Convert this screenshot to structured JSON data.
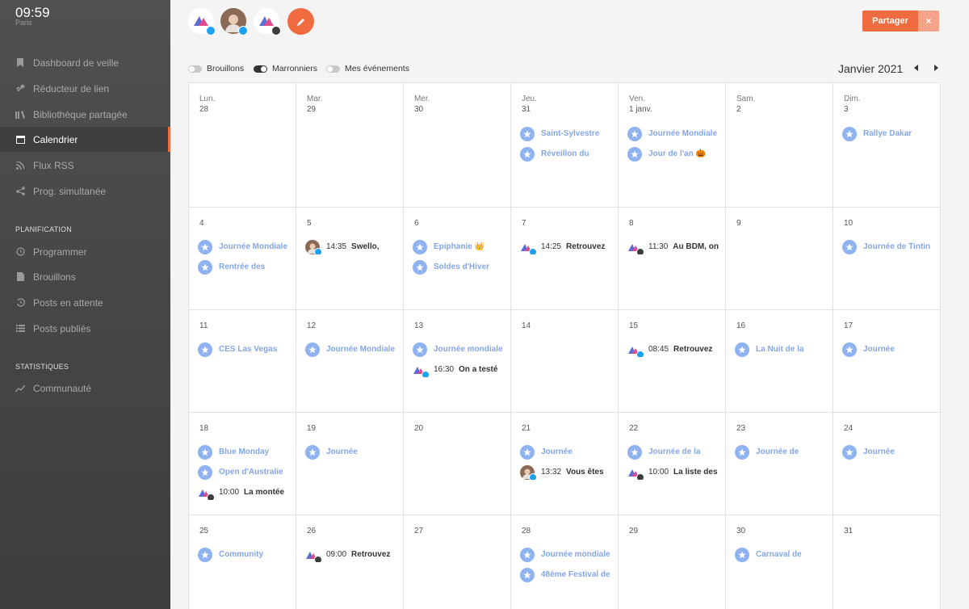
{
  "clock": {
    "time": "09:59",
    "city": "Paris"
  },
  "nav": [
    {
      "label": "Dashboard de veille",
      "icon": "bookmark-icon"
    },
    {
      "label": "Réducteur de lien",
      "icon": "link-icon"
    },
    {
      "label": "Bibliothèque partagée",
      "icon": "library-icon"
    },
    {
      "label": "Calendrier",
      "icon": "calendar-icon",
      "active": true
    },
    {
      "label": "Flux RSS",
      "icon": "rss-icon"
    },
    {
      "label": "Prog. simultanée",
      "icon": "share-icon"
    }
  ],
  "planification": {
    "title": "PLANIFICATION",
    "items": [
      {
        "label": "Programmer",
        "icon": "clock-icon"
      },
      {
        "label": "Brouillons",
        "icon": "draft-icon"
      },
      {
        "label": "Posts en attente",
        "icon": "history-icon"
      },
      {
        "label": "Posts publiés",
        "icon": "list-icon"
      }
    ]
  },
  "statistiques": {
    "title": "STATISTIQUES",
    "items": [
      {
        "label": "Communauté",
        "icon": "chart-line-icon"
      }
    ]
  },
  "toolbar": {
    "share_label": "Partager",
    "close_label": "×"
  },
  "toggles": [
    {
      "label": "Brouillons",
      "on": false
    },
    {
      "label": "Marronniers",
      "on": true
    },
    {
      "label": "Mes événements",
      "on": false
    }
  ],
  "month_label": "Janvier 2021",
  "colors": {
    "accent": "#f06b3f",
    "event_blue": "#84a6e6",
    "twitter": "#1da1f2",
    "facebook": "#3b3d3f"
  },
  "weeks": [
    [
      {
        "dow": "Lun.",
        "day": "28",
        "events": []
      },
      {
        "dow": "Mar.",
        "day": "29",
        "events": []
      },
      {
        "dow": "Mer.",
        "day": "30",
        "events": []
      },
      {
        "dow": "Jeu.",
        "day": "31",
        "events": [
          {
            "type": "star",
            "text": "Saint-Sylvestre"
          },
          {
            "type": "star",
            "text": "Réveillon du"
          }
        ]
      },
      {
        "dow": "Ven.",
        "day": "1 janv.",
        "events": [
          {
            "type": "star",
            "text": "Journée Mondiale"
          },
          {
            "type": "star",
            "text": "Jour de l'an 🎃"
          }
        ]
      },
      {
        "dow": "Sam.",
        "day": "2",
        "events": []
      },
      {
        "dow": "Dim.",
        "day": "3",
        "events": [
          {
            "type": "star",
            "text": "Rallye Dakar"
          }
        ]
      }
    ],
    [
      {
        "day": "4",
        "events": [
          {
            "type": "star",
            "text": "Journée Mondiale"
          },
          {
            "type": "star",
            "text": "Rentrée des"
          }
        ]
      },
      {
        "day": "5",
        "events": [
          {
            "type": "post",
            "avatar": "person",
            "net": "twitter",
            "time": "14:35",
            "text": "Swello,"
          }
        ]
      },
      {
        "day": "6",
        "events": [
          {
            "type": "star",
            "text": "Epiphanie 👑"
          },
          {
            "type": "star",
            "text": "Soldes d'Hiver"
          }
        ]
      },
      {
        "day": "7",
        "events": [
          {
            "type": "post",
            "avatar": "logo",
            "net": "twitter",
            "time": "14:25",
            "text": "Retrouvez"
          }
        ]
      },
      {
        "day": "8",
        "events": [
          {
            "type": "post",
            "avatar": "logo",
            "net": "facebook",
            "time": "11:30",
            "text": "Au BDM, on"
          }
        ]
      },
      {
        "day": "9",
        "events": []
      },
      {
        "day": "10",
        "events": [
          {
            "type": "star",
            "text": "Journée de Tintin"
          }
        ]
      }
    ],
    [
      {
        "day": "11",
        "events": [
          {
            "type": "star",
            "text": "CES Las Vegas"
          }
        ]
      },
      {
        "day": "12",
        "events": [
          {
            "type": "star",
            "text": "Journée Mondiale"
          }
        ]
      },
      {
        "day": "13",
        "events": [
          {
            "type": "star",
            "text": "Journée mondiale"
          },
          {
            "type": "post",
            "avatar": "logo",
            "net": "twitter",
            "time": "16:30",
            "text": "On a testé"
          }
        ]
      },
      {
        "day": "14",
        "events": []
      },
      {
        "day": "15",
        "events": [
          {
            "type": "post",
            "avatar": "logo",
            "net": "twitter",
            "time": "08:45",
            "text": "Retrouvez"
          }
        ]
      },
      {
        "day": "16",
        "events": [
          {
            "type": "star",
            "text": "La Nuit de la"
          }
        ]
      },
      {
        "day": "17",
        "events": [
          {
            "type": "star",
            "text": "Journée"
          }
        ]
      }
    ],
    [
      {
        "day": "18",
        "events": [
          {
            "type": "star",
            "text": "Blue Monday"
          },
          {
            "type": "star",
            "text": "Open d'Australie"
          },
          {
            "type": "post",
            "avatar": "logo",
            "net": "facebook",
            "time": "10:00",
            "text": "La montée"
          }
        ]
      },
      {
        "day": "19",
        "events": [
          {
            "type": "star",
            "text": "Journée"
          }
        ]
      },
      {
        "day": "20",
        "events": []
      },
      {
        "day": "21",
        "events": [
          {
            "type": "star",
            "text": "Journée"
          },
          {
            "type": "post",
            "avatar": "person",
            "net": "twitter",
            "time": "13:32",
            "text": "Vous êtes"
          }
        ]
      },
      {
        "day": "22",
        "events": [
          {
            "type": "star",
            "text": "Journée de la"
          },
          {
            "type": "post",
            "avatar": "logo",
            "net": "facebook",
            "time": "10:00",
            "text": "La liste des"
          }
        ]
      },
      {
        "day": "23",
        "events": [
          {
            "type": "star",
            "text": "Journée de"
          }
        ]
      },
      {
        "day": "24",
        "events": [
          {
            "type": "star",
            "text": "Journée"
          }
        ]
      }
    ],
    [
      {
        "day": "25",
        "events": [
          {
            "type": "star",
            "text": "Community"
          }
        ]
      },
      {
        "day": "26",
        "events": [
          {
            "type": "post",
            "avatar": "logo",
            "net": "facebook",
            "time": "09:00",
            "text": "Retrouvez"
          }
        ]
      },
      {
        "day": "27",
        "events": []
      },
      {
        "day": "28",
        "events": [
          {
            "type": "star",
            "text": "Journée mondiale"
          },
          {
            "type": "star",
            "text": "48ème Festival de"
          }
        ]
      },
      {
        "day": "29",
        "events": []
      },
      {
        "day": "30",
        "events": [
          {
            "type": "star",
            "text": "Carnaval de"
          }
        ]
      },
      {
        "day": "31",
        "events": []
      }
    ]
  ]
}
